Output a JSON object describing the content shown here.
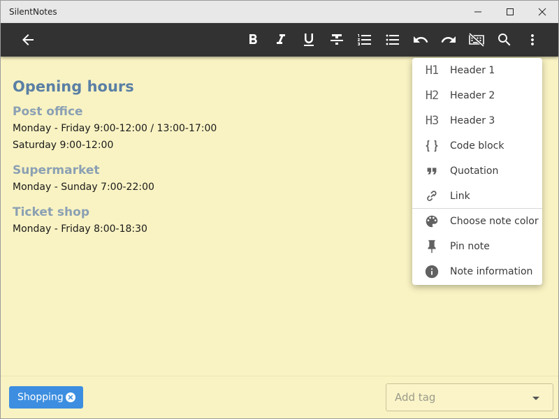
{
  "window": {
    "title": "SilentNotes"
  },
  "toolbar": {
    "buttons": [
      "back",
      "bold",
      "italic",
      "underline",
      "strikethrough",
      "ordered-list",
      "bullet-list",
      "undo",
      "redo",
      "keyboard-off",
      "search",
      "more"
    ]
  },
  "note": {
    "heading": "Opening hours",
    "sections": [
      {
        "title": "Post office",
        "lines": [
          "Monday - Friday 9:00-12:00 / 13:00-17:00",
          "Saturday 9:00-12:00"
        ]
      },
      {
        "title": "Supermarket",
        "lines": [
          "Monday - Sunday 7:00-22:00"
        ]
      },
      {
        "title": "Ticket shop",
        "lines": [
          "Monday - Friday 8:00-18:30"
        ]
      }
    ]
  },
  "menu": {
    "items": [
      {
        "icon": "H1",
        "label": "Header 1"
      },
      {
        "icon": "H2",
        "label": "Header 2"
      },
      {
        "icon": "H3",
        "label": "Header 3"
      },
      {
        "icon": "code-block-icon",
        "label": "Code block"
      },
      {
        "icon": "quotation-icon",
        "label": "Quotation"
      },
      {
        "icon": "link-icon",
        "label": "Link"
      },
      {
        "icon": "palette-icon",
        "label": "Choose note color"
      },
      {
        "icon": "pin-icon",
        "label": "Pin note"
      },
      {
        "icon": "info-icon",
        "label": "Note information"
      }
    ]
  },
  "tags": {
    "items": [
      {
        "label": "Shopping"
      }
    ],
    "add_placeholder": "Add tag"
  },
  "colors": {
    "note_background": "#f9f3c3",
    "toolbar": "#323232",
    "tag": "#3d8ee0",
    "heading1": "#5a7fa5",
    "heading2": "#8ba0b3"
  }
}
